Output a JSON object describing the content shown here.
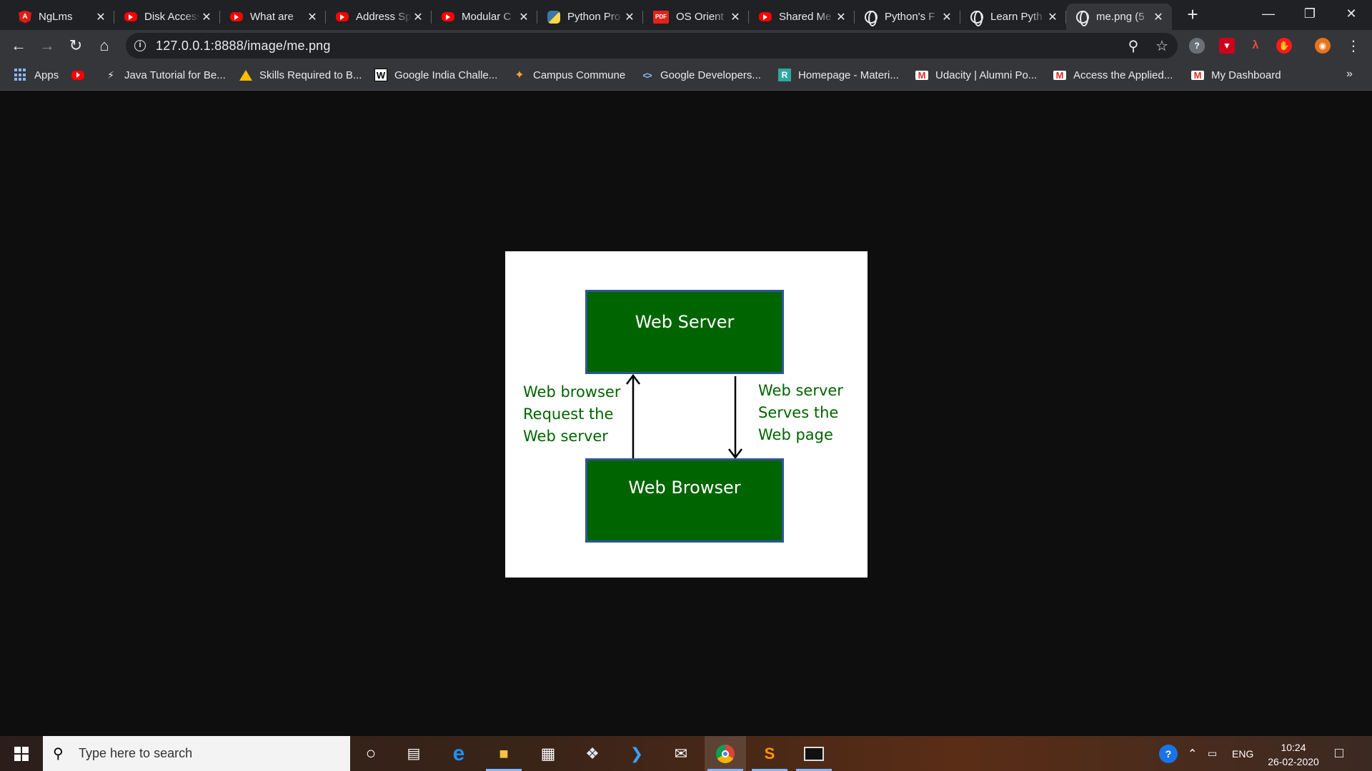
{
  "tabs": [
    {
      "title": "NgLms",
      "favicon": "angular-icon"
    },
    {
      "title": "Disk Access",
      "favicon": "youtube-icon"
    },
    {
      "title": "What are",
      "favicon": "youtube-icon"
    },
    {
      "title": "Address Sp",
      "favicon": "youtube-icon"
    },
    {
      "title": "Modular C",
      "favicon": "youtube-icon"
    },
    {
      "title": "Python Pro",
      "favicon": "python-icon"
    },
    {
      "title": "OS Orient",
      "favicon": "pdf-icon"
    },
    {
      "title": "Shared Me",
      "favicon": "youtube-icon"
    },
    {
      "title": "Python's F",
      "favicon": "globe-icon"
    },
    {
      "title": "Learn Pyth",
      "favicon": "globe-icon"
    },
    {
      "title": "me.png (5",
      "favicon": "globe-icon",
      "active": true
    }
  ],
  "address_bar": {
    "url": "127.0.0.1:8888/image/me.png"
  },
  "bookmarks": {
    "apps_label": "Apps",
    "items": [
      {
        "label": "",
        "icon": "youtube-icon"
      },
      {
        "label": "Java Tutorial for Be...",
        "icon": "bolt-icon"
      },
      {
        "label": "Skills Required to B...",
        "icon": "drive-icon"
      },
      {
        "label": "Google India Challe...",
        "icon": "w-icon"
      },
      {
        "label": "Campus Commune",
        "icon": "campus-icon"
      },
      {
        "label": "Google Developers...",
        "icon": "google-dev-icon"
      },
      {
        "label": "Homepage - Materi...",
        "icon": "r-icon"
      },
      {
        "label": "Udacity | Alumni Po...",
        "icon": "mail-icon"
      },
      {
        "label": "Access the Applied...",
        "icon": "mail-icon"
      },
      {
        "label": "My Dashboard",
        "icon": "mail-icon"
      }
    ],
    "more": "»"
  },
  "diagram": {
    "top_box": "Web Server",
    "bottom_box": "Web Browser",
    "left_note": [
      "Web browser",
      "Request the",
      "Web server"
    ],
    "right_note": [
      "Web server",
      "Serves the",
      "Web page"
    ],
    "box_fill": "#006400",
    "box_border": "#2f5597",
    "note_color": "#006400"
  },
  "taskbar": {
    "search_placeholder": "Type here to search",
    "language": "ENG",
    "time": "10:24",
    "date": "26-02-2020"
  }
}
